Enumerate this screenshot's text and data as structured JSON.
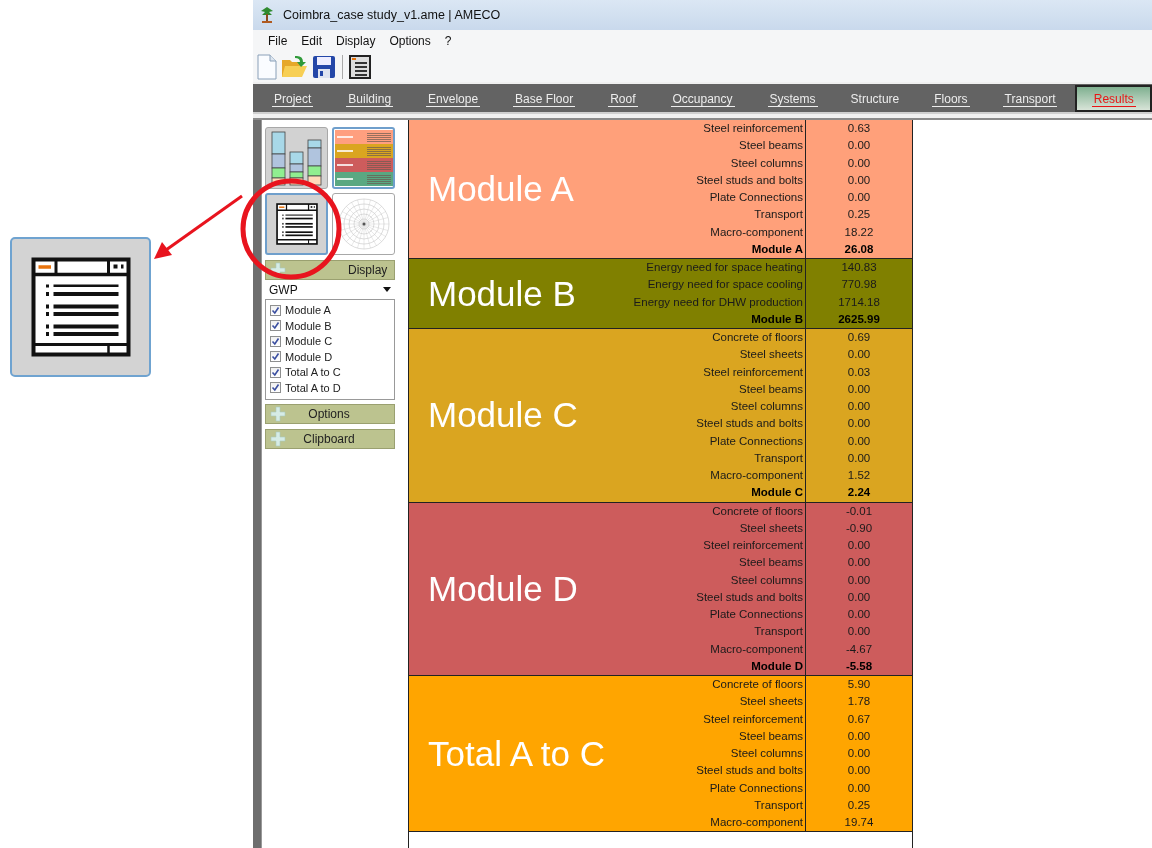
{
  "window": {
    "title": "Coimbra_case study_v1.ame | AMECO"
  },
  "menu": [
    "File",
    "Edit",
    "Display",
    "Options",
    "?"
  ],
  "tabs": [
    {
      "label": "Project",
      "selected": false,
      "underlined": true
    },
    {
      "label": "Building",
      "selected": false,
      "underlined": true
    },
    {
      "label": "Envelope",
      "selected": false,
      "underlined": true
    },
    {
      "label": "Base Floor",
      "selected": false,
      "underlined": true
    },
    {
      "label": "Roof",
      "selected": false,
      "underlined": true
    },
    {
      "label": "Occupancy",
      "selected": false,
      "underlined": true
    },
    {
      "label": "Systems",
      "selected": false,
      "underlined": true
    },
    {
      "label": "Structure",
      "selected": false,
      "underlined": false
    },
    {
      "label": "Floors",
      "selected": false,
      "underlined": true
    },
    {
      "label": "Transport",
      "selected": false,
      "underlined": true
    },
    {
      "label": "Results",
      "selected": true,
      "underlined": true
    }
  ],
  "sidebar": {
    "view_buttons": [
      {
        "kind": "bar-chart",
        "selected": false
      },
      {
        "kind": "table-thumbnail",
        "selected": true
      },
      {
        "kind": "list-view",
        "selected": true
      },
      {
        "kind": "polar-chart",
        "selected": false
      }
    ],
    "display_panel": {
      "header": "Display",
      "metric": "GWP",
      "modules": [
        {
          "label": "Module A",
          "checked": true
        },
        {
          "label": "Module B",
          "checked": true
        },
        {
          "label": "Module C",
          "checked": true
        },
        {
          "label": "Module D",
          "checked": true
        },
        {
          "label": "Total A to C",
          "checked": true
        },
        {
          "label": "Total A to D",
          "checked": true
        }
      ]
    },
    "options_header": "Options",
    "clipboard_header": "Clipboard"
  },
  "results": [
    {
      "title": "Module A",
      "color": "#ffa07a",
      "rows": [
        {
          "label": "Steel reinforcement",
          "value": "0.63"
        },
        {
          "label": "Steel beams",
          "value": "0.00"
        },
        {
          "label": "Steel columns",
          "value": "0.00"
        },
        {
          "label": "Steel studs and bolts",
          "value": "0.00"
        },
        {
          "label": "Plate Connections",
          "value": "0.00"
        },
        {
          "label": "Transport",
          "value": "0.25"
        },
        {
          "label": "Macro-component",
          "value": "18.22"
        }
      ],
      "total": {
        "label": "Module A",
        "value": "26.08"
      }
    },
    {
      "title": "Module B",
      "color": "#808000",
      "rows": [
        {
          "label": "Energy need for space heating",
          "value": "140.83"
        },
        {
          "label": "Energy need for space cooling",
          "value": "770.98"
        },
        {
          "label": "Energy need for DHW production",
          "value": "1714.18"
        }
      ],
      "total": {
        "label": "Module B",
        "value": "2625.99"
      }
    },
    {
      "title": "Module C",
      "color": "#daa520",
      "rows": [
        {
          "label": "Concrete of floors",
          "value": "0.69"
        },
        {
          "label": "Steel sheets",
          "value": "0.00"
        },
        {
          "label": "Steel reinforcement",
          "value": "0.03"
        },
        {
          "label": "Steel beams",
          "value": "0.00"
        },
        {
          "label": "Steel columns",
          "value": "0.00"
        },
        {
          "label": "Steel studs and bolts",
          "value": "0.00"
        },
        {
          "label": "Plate Connections",
          "value": "0.00"
        },
        {
          "label": "Transport",
          "value": "0.00"
        },
        {
          "label": "Macro-component",
          "value": "1.52"
        }
      ],
      "total": {
        "label": "Module C",
        "value": "2.24"
      }
    },
    {
      "title": "Module D",
      "color": "#cd5c5c",
      "rows": [
        {
          "label": "Concrete of floors",
          "value": "-0.01"
        },
        {
          "label": "Steel sheets",
          "value": "-0.90"
        },
        {
          "label": "Steel reinforcement",
          "value": "0.00"
        },
        {
          "label": "Steel beams",
          "value": "0.00"
        },
        {
          "label": "Steel columns",
          "value": "0.00"
        },
        {
          "label": "Steel studs and bolts",
          "value": "0.00"
        },
        {
          "label": "Plate Connections",
          "value": "0.00"
        },
        {
          "label": "Transport",
          "value": "0.00"
        },
        {
          "label": "Macro-component",
          "value": "-4.67"
        }
      ],
      "total": {
        "label": "Module D",
        "value": "-5.58"
      }
    },
    {
      "title": "Total A to C",
      "color": "#ffa500",
      "rows": [
        {
          "label": "Concrete of floors",
          "value": "5.90"
        },
        {
          "label": "Steel sheets",
          "value": "1.78"
        },
        {
          "label": "Steel reinforcement",
          "value": "0.67"
        },
        {
          "label": "Steel beams",
          "value": "0.00"
        },
        {
          "label": "Steel columns",
          "value": "0.00"
        },
        {
          "label": "Steel studs and bolts",
          "value": "0.00"
        },
        {
          "label": "Plate Connections",
          "value": "0.00"
        },
        {
          "label": "Transport",
          "value": "0.25"
        },
        {
          "label": "Macro-component",
          "value": "19.74"
        }
      ]
    }
  ]
}
